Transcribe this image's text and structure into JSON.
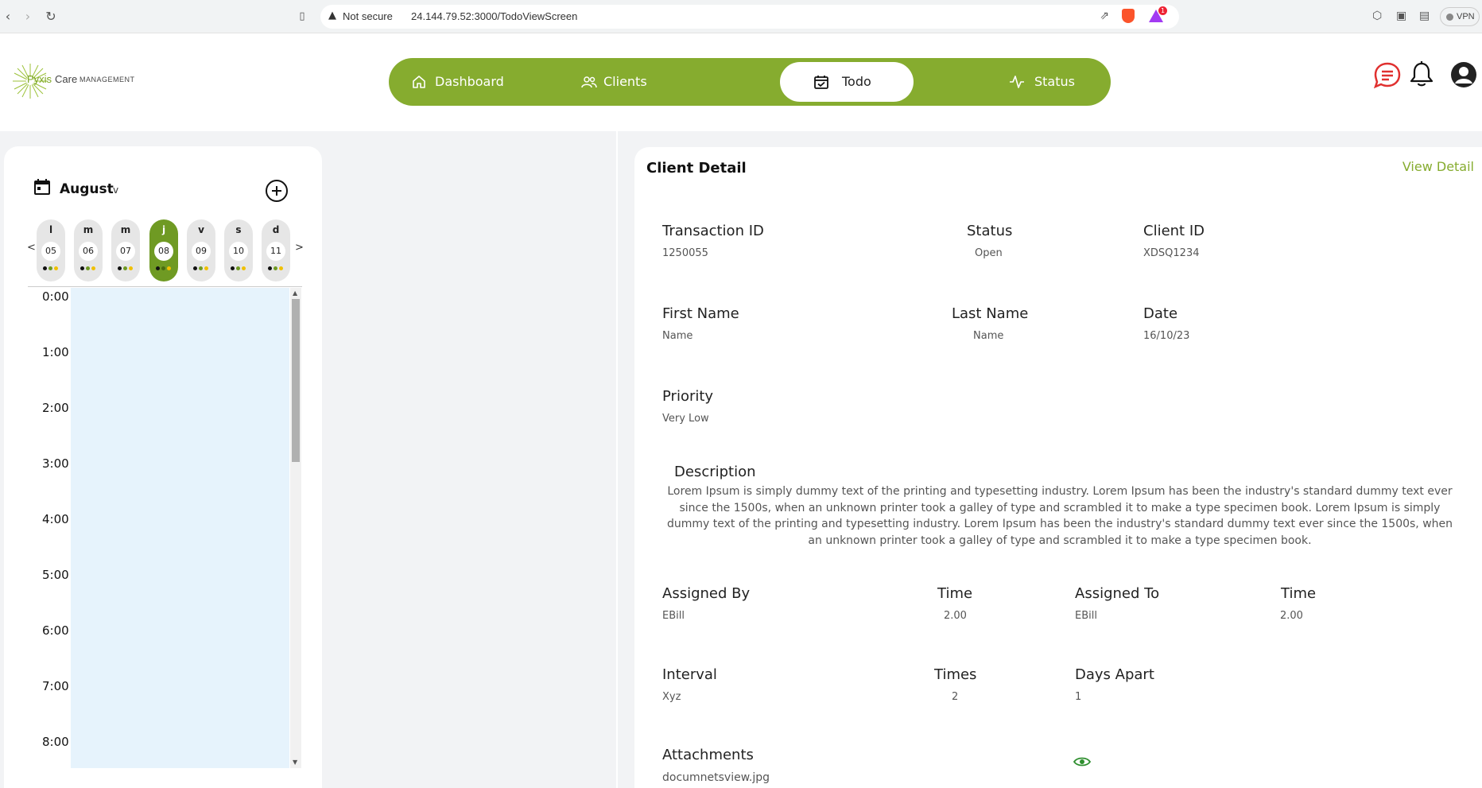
{
  "browser": {
    "security_label": "Not secure",
    "url": "24.144.79.52:3000/TodoViewScreen",
    "notification_badge": "1",
    "vpn_label": "VPN"
  },
  "brand": {
    "name_part1": "Pyxis",
    "name_part2": "Care",
    "name_part3": "MANAGEMENT",
    "accent_color": "#86ac2f"
  },
  "nav": {
    "items": [
      {
        "label": "Dashboard",
        "icon": "home-icon"
      },
      {
        "label": "Clients",
        "icon": "users-icon"
      },
      {
        "label": "Todo",
        "icon": "calendar-check-icon",
        "active": true
      },
      {
        "label": "Status",
        "icon": "activity-icon"
      }
    ]
  },
  "header_icons": [
    "chat-icon",
    "bell-icon",
    "user-avatar-icon"
  ],
  "calendar": {
    "month": "August",
    "caret": "v",
    "prev": "<",
    "next": ">",
    "days": [
      {
        "letter": "l",
        "num": "05"
      },
      {
        "letter": "m",
        "num": "06"
      },
      {
        "letter": "m",
        "num": "07"
      },
      {
        "letter": "j",
        "num": "08",
        "active": true
      },
      {
        "letter": "v",
        "num": "09"
      },
      {
        "letter": "s",
        "num": "10"
      },
      {
        "letter": "d",
        "num": "11"
      }
    ],
    "hours": [
      "0:00",
      "1:00",
      "2:00",
      "3:00",
      "4:00",
      "5:00",
      "6:00",
      "7:00",
      "8:00"
    ]
  },
  "detail": {
    "title": "Client Detail",
    "view_detail": "View Detail",
    "transaction_id_label": "Transaction ID",
    "transaction_id": "1250055",
    "status_label": "Status",
    "status": "Open",
    "client_id_label": "Client ID",
    "client_id": "XDSQ1234",
    "first_name_label": "First Name",
    "first_name": "Name",
    "last_name_label": "Last Name",
    "last_name": "Name",
    "date_label": "Date",
    "date": "16/10/23",
    "priority_label": "Priority",
    "priority": "Very Low",
    "description_label": "Description",
    "description": "Lorem Ipsum is simply dummy text of the printing and typesetting industry. Lorem Ipsum has been the industry's standard dummy text ever since the 1500s, when an unknown printer took a galley of type and scrambled it to make a type specimen book. Lorem Ipsum is simply dummy text of the printing and typesetting industry. Lorem Ipsum has been the industry's standard dummy text ever since the 1500s, when an unknown printer took a galley of type and scrambled it to make a type specimen book.",
    "assigned_by_label": "Assigned By",
    "assigned_by": "EBill",
    "time1_label": "Time",
    "time1": "2.00",
    "assigned_to_label": "Assigned To",
    "assigned_to": "EBill",
    "time2_label": "Time",
    "time2": "2.00",
    "interval_label": "Interval",
    "interval": "Xyz",
    "times_label": "Times",
    "times": "2",
    "days_apart_label": "Days Apart",
    "days_apart": "1",
    "attachments_label": "Attachments",
    "attachment_file": "documnetsview.jpg"
  }
}
